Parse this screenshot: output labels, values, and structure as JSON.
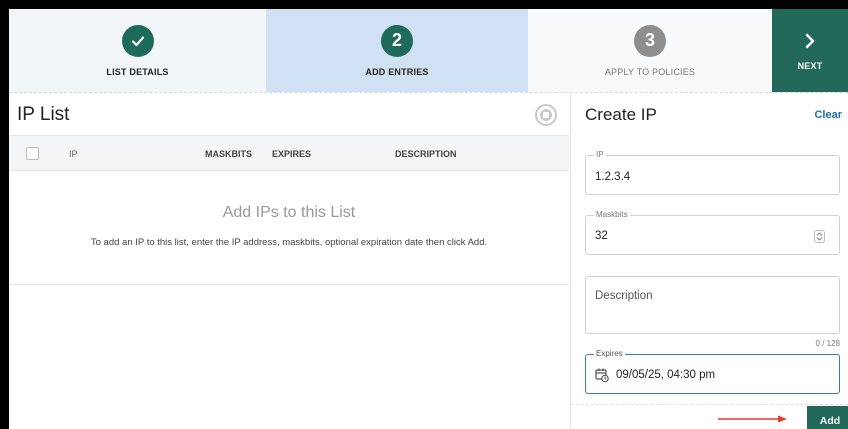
{
  "stepper": {
    "steps": [
      {
        "label": "LIST DETAILS",
        "state": "done",
        "icon": "check-icon"
      },
      {
        "label": "ADD ENTRIES",
        "state": "active",
        "number": "2"
      },
      {
        "label": "APPLY TO POLICIES",
        "state": "pending",
        "number": "3"
      }
    ],
    "next": {
      "label": "NEXT",
      "icon": "chevron-right-icon"
    }
  },
  "ip_list": {
    "title": "IP List",
    "columns": [
      "IP",
      "MASKBITS",
      "EXPIRES",
      "DESCRIPTION"
    ],
    "empty_title": "Add IPs to this List",
    "empty_hint": "To add an IP to this list, enter the IP address, maskbits, optional expiration date then click Add."
  },
  "create_ip": {
    "title": "Create IP",
    "clear_label": "Clear",
    "ip": {
      "label": "IP",
      "value": "1.2.3.4"
    },
    "maskbits": {
      "label": "Maskbits",
      "value": "32"
    },
    "description": {
      "placeholder": "Description",
      "counter": "0 / 128"
    },
    "expires": {
      "label": "Expires",
      "value": "09/05/25, 04:30 pm"
    },
    "add_label": "Add"
  },
  "colors": {
    "primary": "#23695a",
    "active_step": "#cfe1f3",
    "link": "#1f6fb5",
    "arrow": "#e53a2f"
  }
}
